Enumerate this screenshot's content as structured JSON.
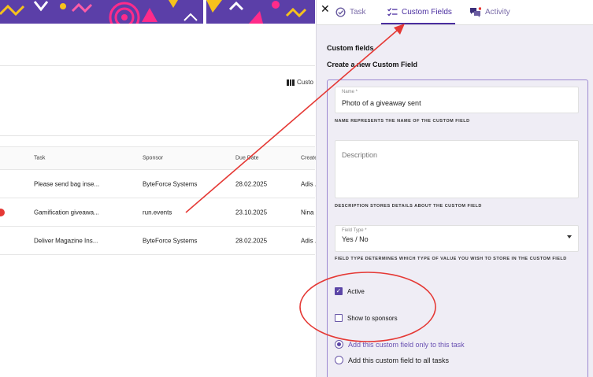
{
  "background": {
    "columns_button_label": "Custo",
    "table": {
      "headers": [
        "Task",
        "Sponsor",
        "Due Date",
        "Create"
      ],
      "rows": [
        {
          "task": "Please send bag inse...",
          "sponsor": "ByteForce Systems",
          "due": "28.02.2025",
          "created": "Adis ."
        },
        {
          "task": "Gamification giveawa...",
          "sponsor": "run.events",
          "due": "23.10.2025",
          "created": "Nina"
        },
        {
          "task": "Deliver Magazine Ins...",
          "sponsor": "ByteForce Systems",
          "due": "28.02.2025",
          "created": "Adis ."
        }
      ]
    }
  },
  "panel": {
    "tabs": [
      {
        "label": "Task",
        "icon": "check-circle-icon"
      },
      {
        "label": "Custom Fields",
        "icon": "checklist-icon"
      },
      {
        "label": "Activity",
        "icon": "chat-bubbles-icon"
      }
    ],
    "active_tab": "Custom Fields",
    "section_title": "Custom fields",
    "subsection_title": "Create a new Custom Field",
    "name_field": {
      "label": "Name *",
      "value": "Photo of a giveaway sent"
    },
    "name_helper": "Name represents the name of the custom field",
    "description_field": {
      "placeholder": "Description",
      "value": ""
    },
    "description_helper": "Description stores details about the custom field",
    "field_type": {
      "label": "Field Type *",
      "value": "Yes / No"
    },
    "field_type_helper": "Field type determines which type of value you wish to store in the custom field",
    "checkboxes": [
      {
        "label": "Active",
        "checked": true
      },
      {
        "label": "Show to sponsors",
        "checked": false
      }
    ],
    "radios": [
      {
        "label": "Add this custom field only to this task",
        "selected": true
      },
      {
        "label": "Add this custom field to all tasks",
        "selected": false
      }
    ]
  },
  "colors": {
    "accent": "#4a2ea0",
    "annotation_red": "#e53935",
    "banner_purple": "#5b3fa8"
  }
}
